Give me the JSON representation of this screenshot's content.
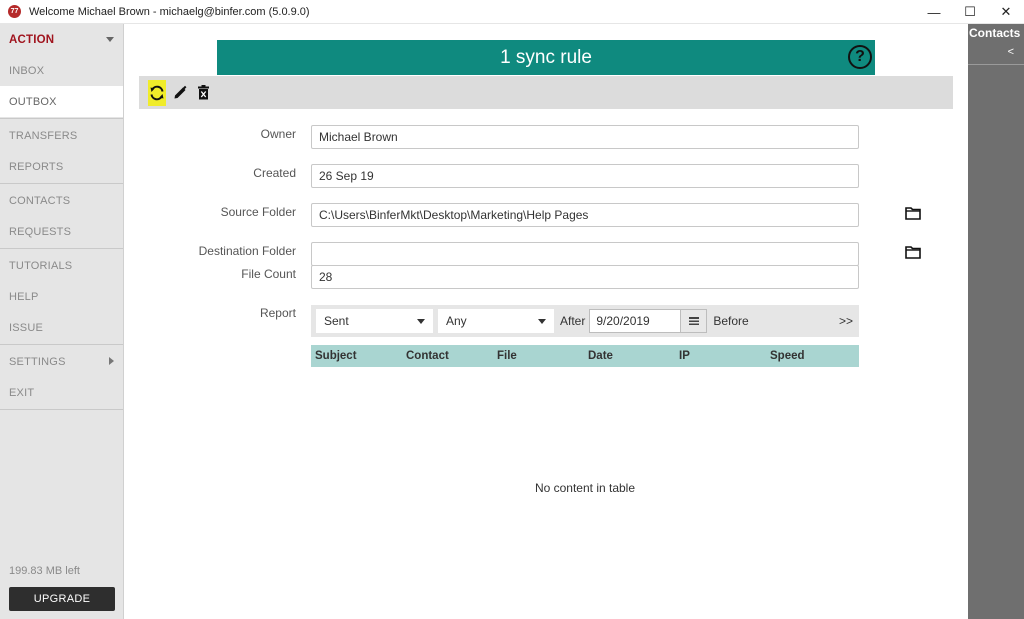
{
  "window": {
    "logo_text": "77",
    "title": "Welcome  Michael Brown - michaelg@binfer.com (5.0.9.0)",
    "minimize": "—",
    "maximize": "☐",
    "close": "✕"
  },
  "sidebar": {
    "items": [
      {
        "label": "ACTION"
      },
      {
        "label": "INBOX"
      },
      {
        "label": "OUTBOX"
      },
      {
        "label": "TRANSFERS"
      },
      {
        "label": "REPORTS"
      },
      {
        "label": "CONTACTS"
      },
      {
        "label": "REQUESTS"
      },
      {
        "label": "TUTORIALS"
      },
      {
        "label": "HELP"
      },
      {
        "label": "ISSUE"
      },
      {
        "label": "SETTINGS"
      },
      {
        "label": "EXIT"
      }
    ],
    "storage_left": "199.83 MB left",
    "upgrade_label": "UPGRADE"
  },
  "contacts_panel": {
    "title": "Contacts",
    "collapse": "<"
  },
  "header": {
    "title": "1 sync rule",
    "help_icon": "?"
  },
  "toolbar": {
    "icons": [
      "sync-icon",
      "edit-icon",
      "delete-icon"
    ]
  },
  "form": {
    "owner_label": "Owner",
    "owner_value": "Michael Brown",
    "created_label": "Created",
    "created_value": "26 Sep 19",
    "source_label": "Source Folder",
    "source_value": "C:\\Users\\BinferMkt\\Desktop\\Marketing\\Help Pages",
    "destination_label": "Destination Folder",
    "destination_value": "",
    "filecount_label": "File Count",
    "filecount_value": "28",
    "report_label": "Report"
  },
  "report_filter": {
    "status_value": "Sent",
    "contact_value": "Any",
    "after_label": "After",
    "after_date": "9/20/2019",
    "before_label": "Before",
    "more": ">>"
  },
  "table": {
    "columns": [
      "Subject",
      "Contact",
      "File",
      "Date",
      "IP",
      "Speed"
    ],
    "rows": [],
    "empty_message": "No content in table"
  },
  "colors": {
    "accent": "#0f8a7f",
    "brand_red": "#a0141e",
    "table_header": "#a9d5d1",
    "highlight": "#f0ec2a"
  }
}
